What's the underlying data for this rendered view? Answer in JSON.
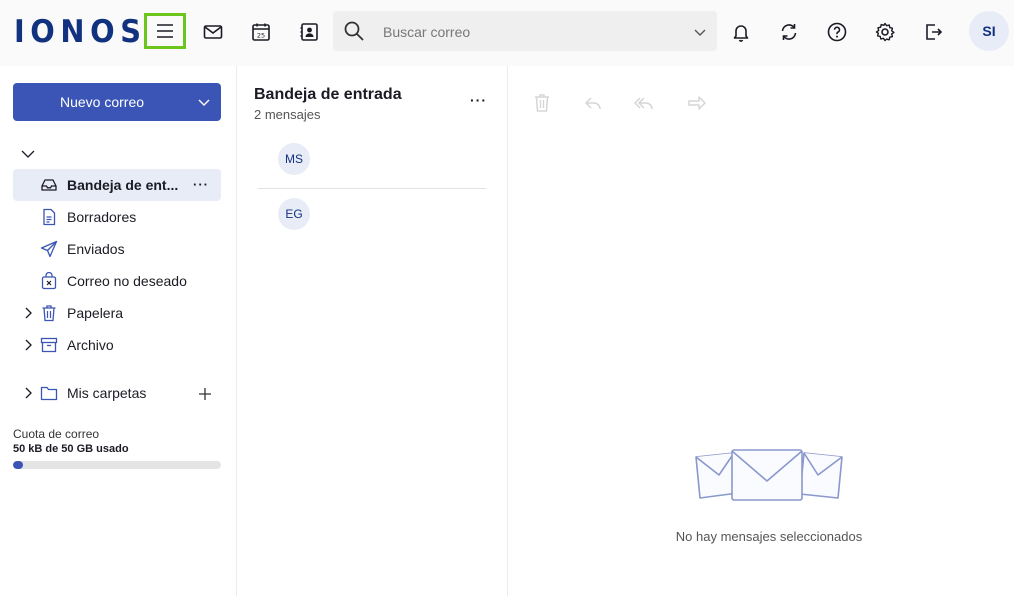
{
  "header": {
    "logo": "IONOS",
    "icons": [
      "menu-icon",
      "mail-icon",
      "calendar-icon",
      "contacts-icon",
      "bell-icon",
      "sync-icon",
      "help-icon",
      "gear-icon",
      "logout-icon"
    ],
    "calendar_day": "25",
    "search_placeholder": "Buscar correo",
    "avatar_initials": "SI",
    "accent_color": "#11327e",
    "highlight_color": "#6cc51c"
  },
  "sidebar": {
    "new_mail_label": "Nuevo correo",
    "folders": [
      {
        "label": "Bandeja de ent...",
        "icon": "inbox-icon",
        "active": true,
        "more": "···"
      },
      {
        "label": "Borradores",
        "icon": "draft-icon"
      },
      {
        "label": "Enviados",
        "icon": "send-icon"
      },
      {
        "label": "Correo no deseado",
        "icon": "spam-icon"
      },
      {
        "label": "Papelera",
        "icon": "trash-icon",
        "expandable": true
      },
      {
        "label": "Archivo",
        "icon": "archive-icon",
        "expandable": true
      }
    ],
    "my_folders_label": "Mis carpetas",
    "quota_title": "Cuota de correo",
    "quota_used": "50 kB de 50 GB usado",
    "quota_fraction": 0.05,
    "button_color": "#3a55b5"
  },
  "message_list": {
    "title": "Bandeja de entrada",
    "count": "2 mensajes",
    "more": "···",
    "messages": [
      {
        "initials": "MS"
      },
      {
        "initials": "EG"
      }
    ]
  },
  "reader": {
    "empty_text": "No hay mensajes seleccionados",
    "toolbar_icons": [
      "trash-icon",
      "reply-icon",
      "reply-all-icon",
      "forward-icon"
    ]
  }
}
